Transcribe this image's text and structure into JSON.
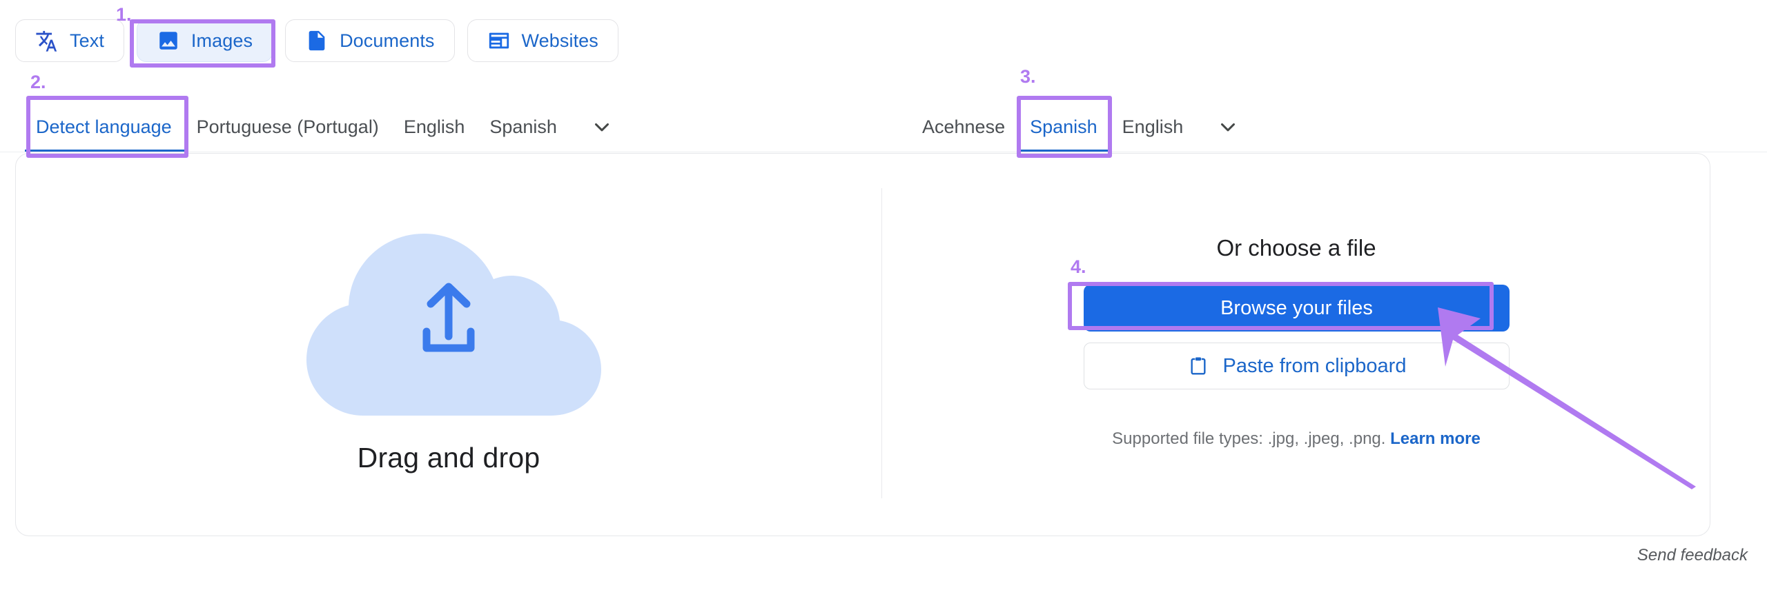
{
  "tabs": [
    {
      "label": "Text",
      "icon": "translate-icon",
      "active": false
    },
    {
      "label": "Images",
      "icon": "image-icon",
      "active": true
    },
    {
      "label": "Documents",
      "icon": "document-icon",
      "active": false
    },
    {
      "label": "Websites",
      "icon": "website-icon",
      "active": false
    }
  ],
  "source_languages": {
    "items": [
      "Detect language",
      "Portuguese (Portugal)",
      "English",
      "Spanish"
    ],
    "selected": "Detect language",
    "more_icon": "chevron-down-icon"
  },
  "swap_icon": "swap-languages-icon",
  "target_languages": {
    "items": [
      "Acehnese",
      "Spanish",
      "English"
    ],
    "selected": "Spanish",
    "more_icon": "chevron-down-icon"
  },
  "dropzone": {
    "icon": "cloud-upload-icon",
    "label": "Drag and drop"
  },
  "choose_file": {
    "title": "Or choose a file",
    "browse_label": "Browse your files",
    "paste_label": "Paste from clipboard",
    "paste_icon": "clipboard-icon",
    "supported_text": "Supported file types: .jpg, .jpeg, .png.",
    "learn_more_label": "Learn more"
  },
  "footer": {
    "send_feedback_label": "Send feedback"
  },
  "annotations": {
    "color": "#b07af0",
    "steps": [
      {
        "number": "1.",
        "target": "Images tab"
      },
      {
        "number": "2.",
        "target": "Detect language"
      },
      {
        "number": "3.",
        "target": "Spanish"
      },
      {
        "number": "4.",
        "target": "Browse your files"
      }
    ],
    "arrow_icon": "pointer-arrow"
  },
  "colors": {
    "accent_blue": "#1b6ae4",
    "link_blue": "#1b66c9",
    "annotation_purple": "#b07af0",
    "cloud_blue": "#cfe0fb"
  }
}
